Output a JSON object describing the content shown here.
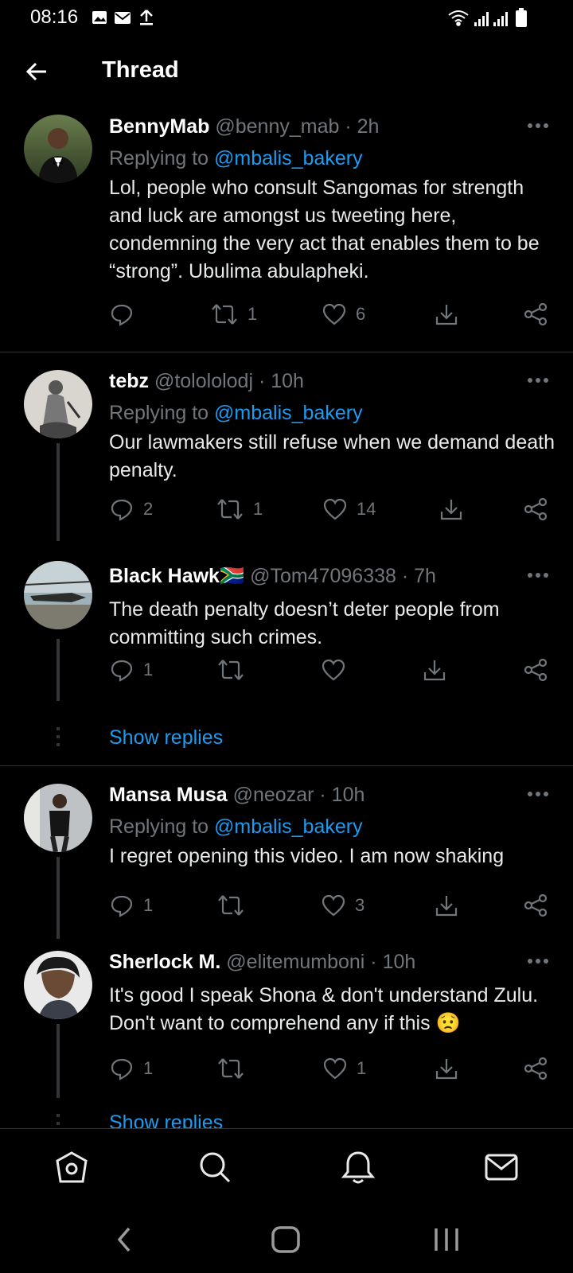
{
  "status_bar": {
    "time": "08:16",
    "icons_left": [
      "gallery-icon",
      "mail-icon",
      "upload-icon"
    ],
    "icons_right": [
      "wifi-icon",
      "signal-icon",
      "signal-icon",
      "battery-icon"
    ]
  },
  "header": {
    "title": "Thread",
    "back_icon": "arrow-left-icon"
  },
  "tweets": [
    {
      "name": "BennyMab",
      "handle": "@benny_mab",
      "time": "· 2h",
      "replying_prefix": "Replying to",
      "replying_handle": "@mbalis_bakery",
      "text": "Lol, people who consult Sangomas for strength and luck are amongst us tweeting here, condemning the very act that enables them to be “strong”. Ubulima abulapheki.",
      "replies": "",
      "retweets": "1",
      "likes": "6"
    },
    {
      "name": "tebz",
      "handle": "@tolololodj",
      "time": "· 10h",
      "replying_prefix": "Replying to",
      "replying_handle": "@mbalis_bakery",
      "text": "Our lawmakers still refuse when we demand death penalty.",
      "replies": "2",
      "retweets": "1",
      "likes": "14"
    },
    {
      "name": "Black Hawk",
      "flag": "🇿🇦",
      "handle": "@Tom47096338",
      "time": "· 7h",
      "text": "The death penalty doesn’t deter people from committing such crimes.",
      "replies": "1",
      "retweets": "",
      "likes": ""
    },
    {
      "name": "Mansa Musa",
      "handle": "@neozar",
      "time": "· 10h",
      "replying_prefix": "Replying to",
      "replying_handle": "@mbalis_bakery",
      "text": "I regret opening this video. I am now shaking",
      "replies": "1",
      "retweets": "",
      "likes": "3"
    },
    {
      "name": "Sherlock M.",
      "handle": "@elitemumboni",
      "time": "· 10h",
      "text": "It's good I speak Shona & don't understand Zulu. Don't want to comprehend any if this 😟",
      "replies": "1",
      "retweets": "",
      "likes": "1"
    }
  ],
  "show_replies": "Show replies",
  "bottom_nav": [
    "home-icon",
    "search-icon",
    "bell-icon",
    "mail-icon"
  ],
  "colors": {
    "background": "#000000",
    "text": "#e7e9ea",
    "muted": "#71767b",
    "link": "#1d9bf0",
    "divider": "#2f3336"
  }
}
